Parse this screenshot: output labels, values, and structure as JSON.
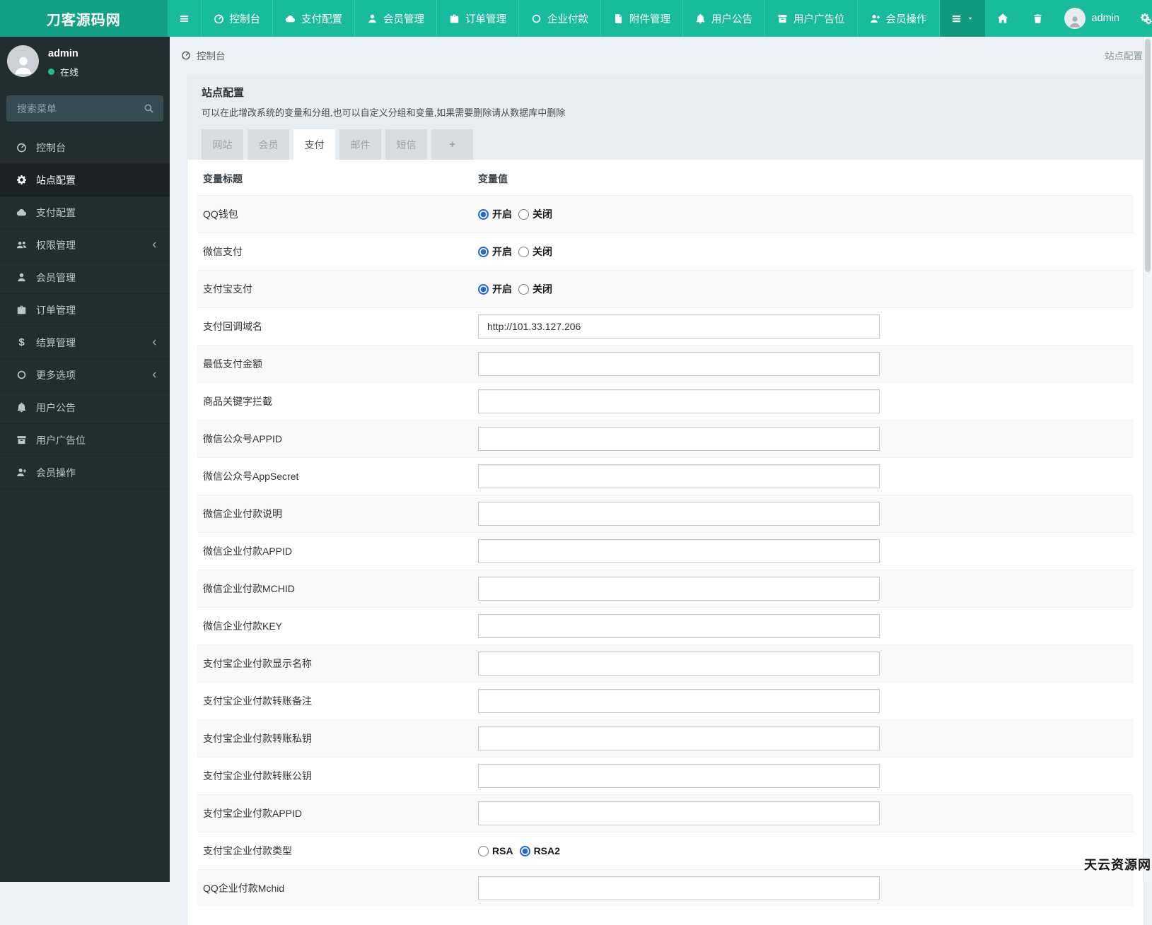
{
  "navbar": {
    "brand": "刀客源码网",
    "items": [
      {
        "label": "控制台",
        "icon": "tachometer-icon"
      },
      {
        "label": "支付配置",
        "icon": "cloud-icon"
      },
      {
        "label": "会员管理",
        "icon": "user-icon"
      },
      {
        "label": "订单管理",
        "icon": "briefcase-icon"
      },
      {
        "label": "企业付款",
        "icon": "circle-icon"
      },
      {
        "label": "附件管理",
        "icon": "file-icon"
      },
      {
        "label": "用户公告",
        "icon": "bell-icon"
      },
      {
        "label": "用户广告位",
        "icon": "archive-icon"
      },
      {
        "label": "会员操作",
        "icon": "user-plus-icon"
      }
    ],
    "user_label": "admin"
  },
  "sidebar": {
    "user_name": "admin",
    "user_status": "在线",
    "search_placeholder": "搜索菜单",
    "items": [
      {
        "label": "控制台",
        "active": false,
        "arrow": false
      },
      {
        "label": "站点配置",
        "active": true,
        "arrow": false
      },
      {
        "label": "支付配置",
        "active": false,
        "arrow": false
      },
      {
        "label": "权限管理",
        "active": false,
        "arrow": true
      },
      {
        "label": "会员管理",
        "active": false,
        "arrow": false
      },
      {
        "label": "订单管理",
        "active": false,
        "arrow": false
      },
      {
        "label": "结算管理",
        "active": false,
        "arrow": true
      },
      {
        "label": "更多选项",
        "active": false,
        "arrow": true
      },
      {
        "label": "用户公告",
        "active": false,
        "arrow": false
      },
      {
        "label": "用户广告位",
        "active": false,
        "arrow": false
      },
      {
        "label": "会员操作",
        "active": false,
        "arrow": false
      }
    ]
  },
  "breadcrumb": {
    "left": "控制台",
    "right": "站点配置"
  },
  "panel": {
    "title": "站点配置",
    "description": "可以在此增改系统的变量和分组,也可以自定义分组和变量,如果需要删除请从数据库中删除",
    "tabs": [
      {
        "label": "网站",
        "active": false
      },
      {
        "label": "会员",
        "active": false
      },
      {
        "label": "支付",
        "active": true
      },
      {
        "label": "邮件",
        "active": false
      },
      {
        "label": "短信",
        "active": false
      },
      {
        "label": "+",
        "active": false
      }
    ]
  },
  "table": {
    "headers": [
      "变量标题",
      "变量值"
    ],
    "rows": [
      {
        "label": "QQ钱包",
        "type": "radio",
        "options": [
          {
            "label": "开启",
            "checked": true
          },
          {
            "label": "关闭",
            "checked": false
          }
        ]
      },
      {
        "label": "微信支付",
        "type": "radio",
        "options": [
          {
            "label": "开启",
            "checked": true
          },
          {
            "label": "关闭",
            "checked": false
          }
        ]
      },
      {
        "label": "支付宝支付",
        "type": "radio",
        "options": [
          {
            "label": "开启",
            "checked": true
          },
          {
            "label": "关闭",
            "checked": false
          }
        ]
      },
      {
        "label": "支付回调域名",
        "type": "input",
        "value": "http://101.33.127.206"
      },
      {
        "label": "最低支付金额",
        "type": "input",
        "value": ""
      },
      {
        "label": "商品关键字拦截",
        "type": "input",
        "value": ""
      },
      {
        "label": "微信公众号APPID",
        "type": "input",
        "value": ""
      },
      {
        "label": "微信公众号AppSecret",
        "type": "input",
        "value": ""
      },
      {
        "label": "微信企业付款说明",
        "type": "input",
        "value": ""
      },
      {
        "label": "微信企业付款APPID",
        "type": "input",
        "value": ""
      },
      {
        "label": "微信企业付款MCHID",
        "type": "input",
        "value": ""
      },
      {
        "label": "微信企业付款KEY",
        "type": "input",
        "value": ""
      },
      {
        "label": "支付宝企业付款显示名称",
        "type": "input",
        "value": ""
      },
      {
        "label": "支付宝企业付款转账备注",
        "type": "input",
        "value": ""
      },
      {
        "label": "支付宝企业付款转账私钥",
        "type": "input",
        "value": ""
      },
      {
        "label": "支付宝企业付款转账公钥",
        "type": "input",
        "value": ""
      },
      {
        "label": "支付宝企业付款APPID",
        "type": "input",
        "value": ""
      },
      {
        "label": "支付宝企业付款类型",
        "type": "radio",
        "options": [
          {
            "label": "RSA",
            "checked": false
          },
          {
            "label": "RSA2",
            "checked": true
          }
        ]
      },
      {
        "label": "QQ企业付款Mchid",
        "type": "input",
        "value": ""
      }
    ]
  },
  "watermark": "天云资源网",
  "colors": {
    "navbar": "#18bc9c",
    "navbar_logo": "#13a185",
    "navbar_toggle": "#12997e",
    "sidebar": "#222d32",
    "sidebar_active": "#1a2226",
    "accent": "#1abc9c",
    "radio_checked": "#2268d2",
    "panel_header": "#e8edf1",
    "content_bg": "#edf1f5",
    "stripe": "#f9f9f9"
  }
}
